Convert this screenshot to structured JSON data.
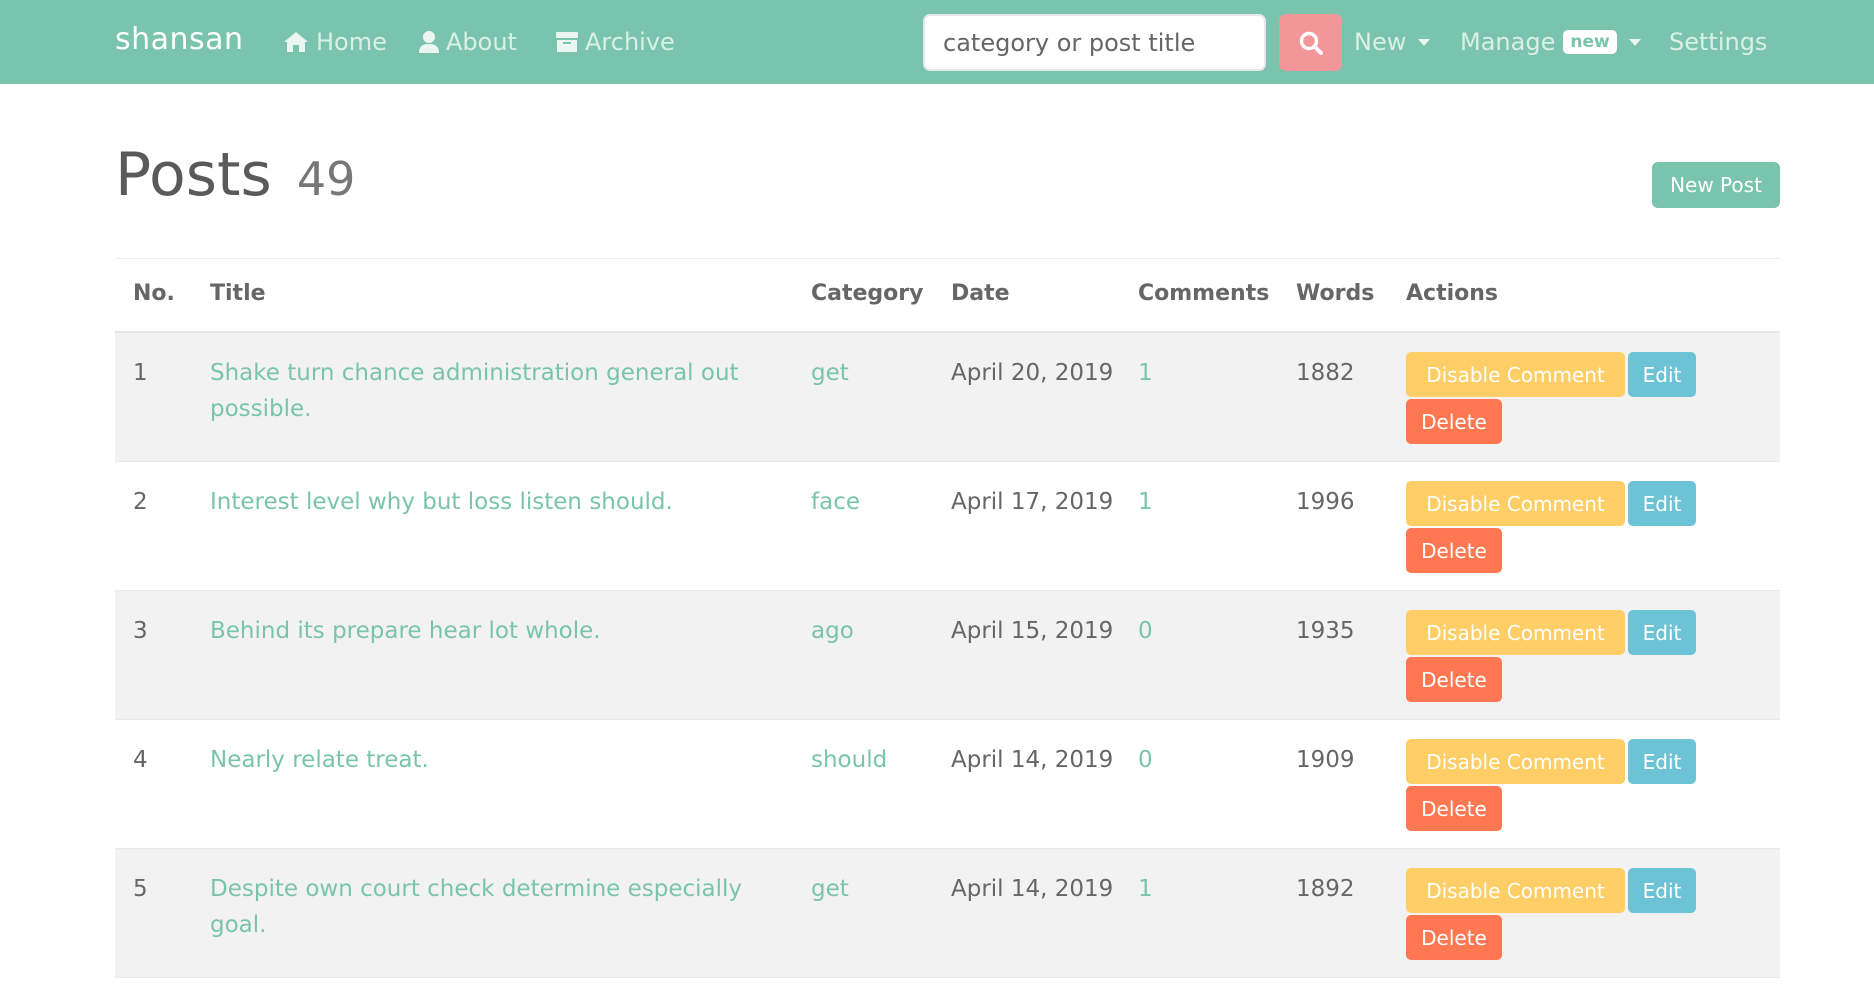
{
  "navbar": {
    "brand": "shansan",
    "home_label": "Home",
    "about_label": "About",
    "archive_label": "Archive",
    "search_placeholder": "category or post title",
    "new_label": "New",
    "manage_label": "Manage",
    "manage_badge": "new",
    "settings_label": "Settings"
  },
  "header": {
    "title": "Posts",
    "count": "49",
    "new_post_label": "New Post"
  },
  "table": {
    "headers": {
      "no": "No.",
      "title": "Title",
      "category": "Category",
      "date": "Date",
      "comments": "Comments",
      "words": "Words",
      "actions": "Actions"
    },
    "rows": [
      {
        "no": "1",
        "title": "Shake turn chance administration general out possible.",
        "category": "get",
        "date": "April 20, 2019",
        "comments": "1",
        "words": "1882"
      },
      {
        "no": "2",
        "title": "Interest level why but loss listen should.",
        "category": "face",
        "date": "April 17, 2019",
        "comments": "1",
        "words": "1996"
      },
      {
        "no": "3",
        "title": "Behind its prepare hear lot whole.",
        "category": "ago",
        "date": "April 15, 2019",
        "comments": "0",
        "words": "1935"
      },
      {
        "no": "4",
        "title": "Nearly relate treat.",
        "category": "should",
        "date": "April 14, 2019",
        "comments": "0",
        "words": "1909"
      },
      {
        "no": "5",
        "title": "Despite own court check determine especially goal.",
        "category": "get",
        "date": "April 14, 2019",
        "comments": "1",
        "words": "1892"
      }
    ],
    "actions": {
      "disable_comment_label": "Disable Comment",
      "edit_label": "Edit",
      "delete_label": "Delete"
    }
  },
  "colors": {
    "primary": "#7ac4ad",
    "search_button": "#f3969a",
    "warning": "#ffce67",
    "info": "#6cc3d5",
    "danger": "#ff7851"
  },
  "icons": {
    "home": "home-icon",
    "about": "user-icon",
    "archive": "archive-icon",
    "search": "search-icon"
  }
}
